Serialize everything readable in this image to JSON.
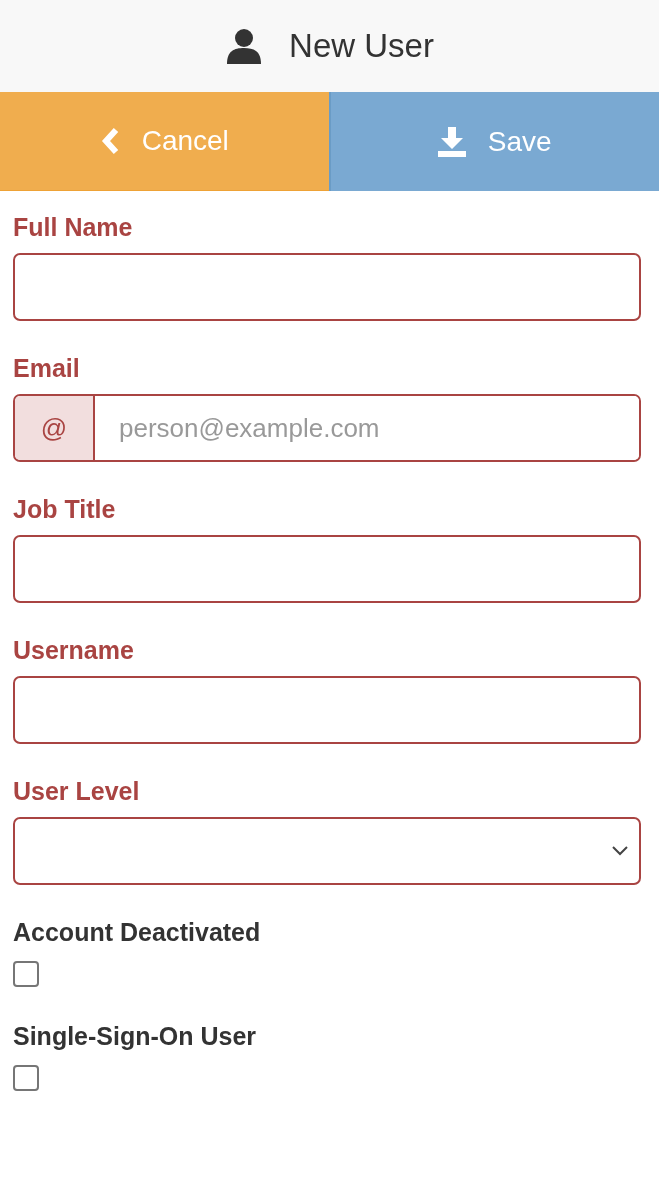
{
  "header": {
    "title": "New User"
  },
  "actions": [
    {
      "label": "Cancel",
      "kind": "cancel"
    },
    {
      "label": "Save",
      "kind": "save"
    }
  ],
  "fields": [
    {
      "label": "Full Name",
      "kind": "text",
      "invalid": true
    },
    {
      "label": "Email",
      "kind": "email",
      "invalid": true,
      "addon": "@",
      "placeholder": "person@example.com"
    },
    {
      "label": "Job Title",
      "kind": "text",
      "invalid": true
    },
    {
      "label": "Username",
      "kind": "text",
      "invalid": true
    },
    {
      "label": "User Level",
      "kind": "select",
      "invalid": true
    }
  ],
  "checkboxes": [
    {
      "label": "Account Deactivated",
      "checked": false
    },
    {
      "label": "Single-Sign-On User",
      "checked": false
    }
  ]
}
